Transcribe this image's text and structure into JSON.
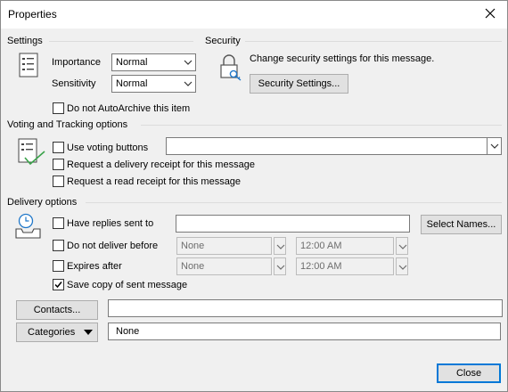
{
  "window": {
    "title": "Properties"
  },
  "settings": {
    "heading": "Settings",
    "importance_label": "Importance",
    "importance_value": "Normal",
    "sensitivity_label": "Sensitivity",
    "sensitivity_value": "Normal",
    "autoarchive_label": "Do not AutoArchive this item"
  },
  "security": {
    "heading": "Security",
    "description": "Change security settings for this message.",
    "button_label": "Security Settings..."
  },
  "voting": {
    "heading": "Voting and Tracking options",
    "use_voting_label": "Use voting buttons",
    "voting_value": "",
    "delivery_receipt_label": "Request a delivery receipt for this message",
    "read_receipt_label": "Request a read receipt for this message"
  },
  "delivery": {
    "heading": "Delivery options",
    "replies_label": "Have replies sent to",
    "replies_value": "",
    "select_names_label": "Select Names...",
    "do_not_deliver_label": "Do not deliver before",
    "do_not_deliver_date": "None",
    "do_not_deliver_time": "12:00 AM",
    "expires_label": "Expires after",
    "expires_date": "None",
    "expires_time": "12:00 AM",
    "save_copy_label": "Save copy of sent message",
    "save_copy_checked": true
  },
  "contacts": {
    "button_label": "Contacts...",
    "value": ""
  },
  "categories": {
    "button_label": "Categories",
    "value": "None"
  },
  "footer": {
    "close_label": "Close"
  },
  "colors": {
    "accent": "#0078d7",
    "check_green": "#3aa34a",
    "dialog_bg": "#f0f0f0"
  }
}
